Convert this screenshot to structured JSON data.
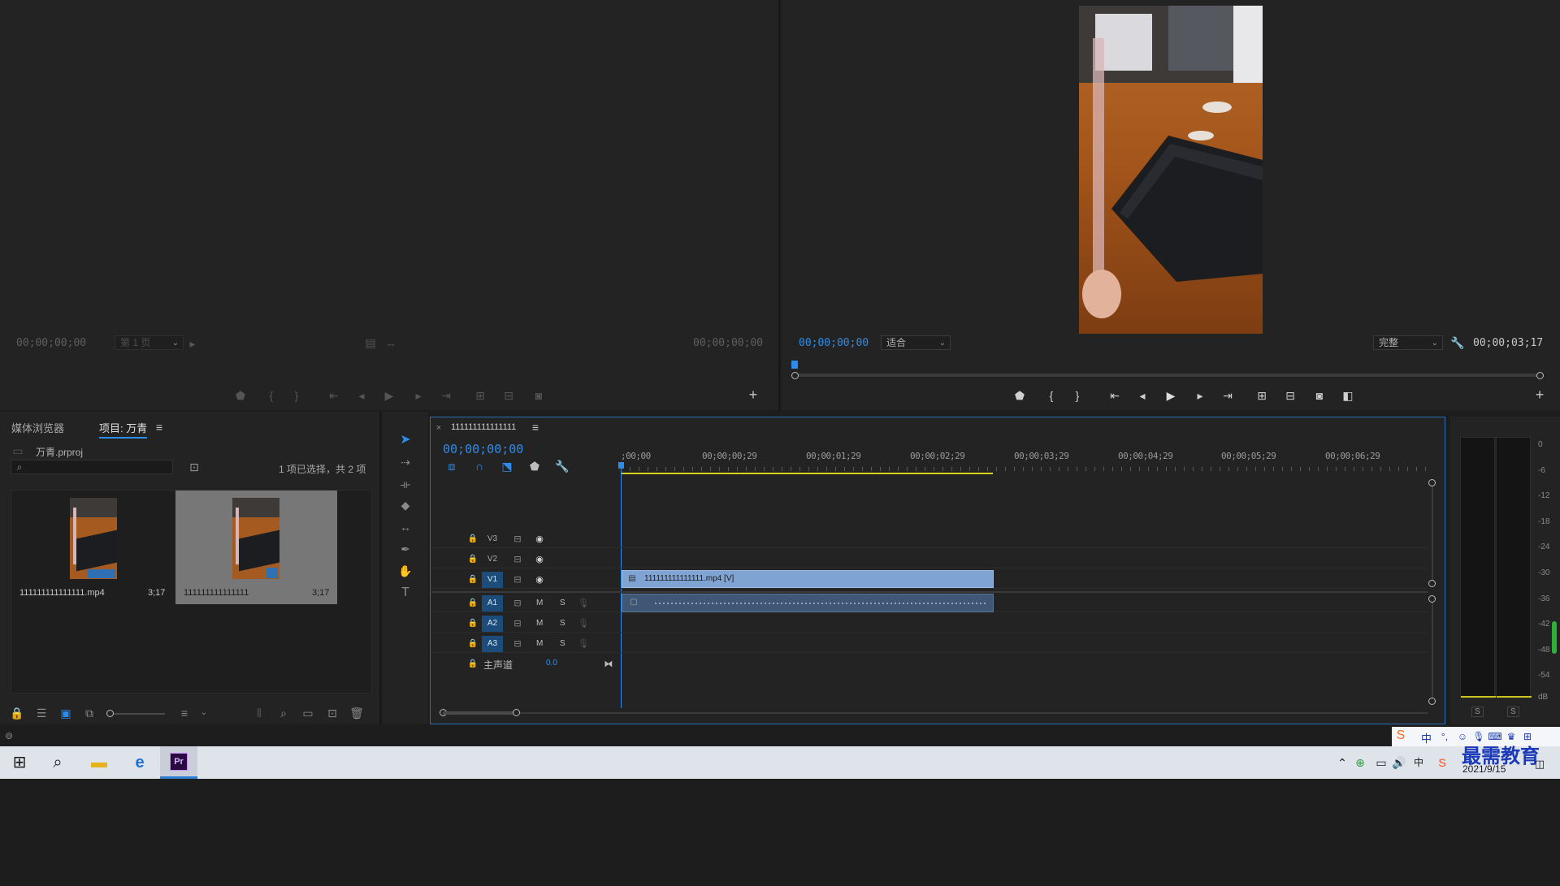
{
  "source_monitor": {
    "timecode_left": "00;00;00;00",
    "page_select": "第 1 页",
    "timecode_right": "00;00;00;00"
  },
  "program_monitor": {
    "timecode_left": "00;00;00;00",
    "fit_select": "适合",
    "quality_select": "完整",
    "timecode_right": "00;00;03;17",
    "playhead_fraction": 0
  },
  "project_panel": {
    "tabs": [
      "媒体浏览器",
      "项目: 万青"
    ],
    "project_file": "万青.prproj",
    "search_placeholder": "",
    "selection_status": "1 项已选择，共 2 项",
    "items": [
      {
        "name": "111111111111111.mp4",
        "duration": "3;17"
      },
      {
        "name": "111111111111111",
        "duration": "3;17"
      }
    ]
  },
  "timeline": {
    "sequence_tab": "111111111111111",
    "timecode": "00;00;00;00",
    "ruler_labels": [
      ";00;00",
      "00;00;00;29",
      "00;00;01;29",
      "00;00;02;29",
      "00;00;03;29",
      "00;00;04;29",
      "00;00;05;29",
      "00;00;06;29"
    ],
    "video_tracks": [
      "V3",
      "V2",
      "V1"
    ],
    "audio_tracks": [
      "A1",
      "A2",
      "A3"
    ],
    "master_label": "主声道",
    "master_value": "0.0",
    "mute_label": "M",
    "solo_label": "S",
    "video_clip_label": "111111111111111.mp4 [V]"
  },
  "audio_meter": {
    "scale": [
      "0",
      "-6",
      "-12",
      "-18",
      "-24",
      "-30",
      "-36",
      "-42",
      "-48",
      "-54",
      "dB"
    ],
    "solo_buttons": [
      "S",
      "S"
    ]
  },
  "taskbar": {
    "date": "2021/9/15",
    "ime": "中",
    "watermark": "最需教育"
  },
  "colors": {
    "accent_blue": "#2d8ceb",
    "video_clip": "#7fa3d3",
    "audio_clip": "#3f5775",
    "work_area": "#d8d31a"
  }
}
